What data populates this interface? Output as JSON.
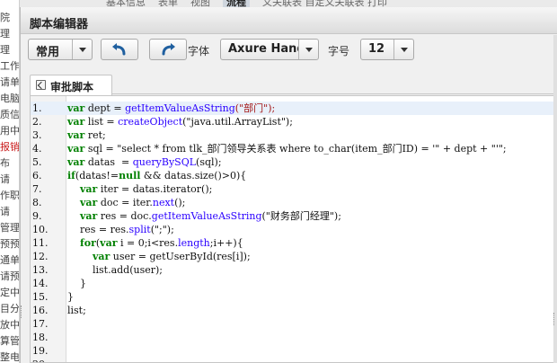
{
  "background": {
    "side_rows": [
      {
        "text": "院",
        "red": false
      },
      {
        "text": "理",
        "red": false
      },
      {
        "text": "理",
        "red": false
      },
      {
        "text": "工作",
        "red": false
      },
      {
        "text": "请单",
        "red": false
      },
      {
        "text": "电脑",
        "red": false
      },
      {
        "text": "质信",
        "red": false
      },
      {
        "text": "用中",
        "red": false
      },
      {
        "text": "报销",
        "red": true
      },
      {
        "text": "布",
        "red": false
      },
      {
        "text": "请",
        "red": false
      },
      {
        "text": "作职",
        "red": false
      },
      {
        "text": "请",
        "red": false
      },
      {
        "text": "管理",
        "red": false
      },
      {
        "text": "预预",
        "red": false
      },
      {
        "text": "通单",
        "red": false
      },
      {
        "text": "请预",
        "red": false
      },
      {
        "text": "定中",
        "red": false
      },
      {
        "text": "目分",
        "red": false
      },
      {
        "text": "放中",
        "red": false
      },
      {
        "text": "算管",
        "red": false
      },
      {
        "text": "整电",
        "red": false
      }
    ],
    "top_tabs": [
      "基本信息",
      "表单",
      "视图"
    ],
    "top_tab_active": "流程",
    "top_tabs_more": "义关联表    自定义关联表    打印"
  },
  "dialog": {
    "title": "脚本编辑器",
    "toolbar": {
      "category_value": "常用",
      "font_label": "字体",
      "font_value": "Axure Handwriting",
      "size_label": "字号",
      "size_value": "12"
    },
    "tab_label": "审批脚本"
  },
  "editor": {
    "current_line": 1,
    "lines": [
      {
        "num": "1.",
        "tokens": [
          {
            "t": "var",
            "c": "kw"
          },
          {
            "t": " dept = ",
            "c": ""
          },
          {
            "t": "getItemValueAsString",
            "c": "fn"
          },
          {
            "t": "(\"部门\");",
            "c": "str"
          }
        ]
      },
      {
        "num": "2.",
        "tokens": [
          {
            "t": "var",
            "c": "kw"
          },
          {
            "t": " list = ",
            "c": ""
          },
          {
            "t": "createObject",
            "c": "fn"
          },
          {
            "t": "(\"java.util.ArrayList\");",
            "c": ""
          }
        ]
      },
      {
        "num": "3.",
        "tokens": [
          {
            "t": "var",
            "c": "kw"
          },
          {
            "t": " ret;",
            "c": ""
          }
        ]
      },
      {
        "num": "4.",
        "tokens": [
          {
            "t": "var",
            "c": "kw"
          },
          {
            "t": " sql = \"select * from tlk_部门领导关系表 where to_char(item_部门ID) = '\" + dept + \"'\";",
            "c": ""
          }
        ]
      },
      {
        "num": "5.",
        "tokens": [
          {
            "t": "var",
            "c": "kw"
          },
          {
            "t": " datas  = ",
            "c": ""
          },
          {
            "t": "queryBySQL",
            "c": "fn"
          },
          {
            "t": "(sql);",
            "c": ""
          }
        ]
      },
      {
        "num": "6.",
        "tokens": [
          {
            "t": "if",
            "c": "kw"
          },
          {
            "t": "(datas!=",
            "c": ""
          },
          {
            "t": "null",
            "c": "kw"
          },
          {
            "t": " && datas.size()>0){",
            "c": ""
          }
        ]
      },
      {
        "num": "7.",
        "tokens": [
          {
            "t": "    ",
            "c": ""
          },
          {
            "t": "var",
            "c": "kw"
          },
          {
            "t": " iter = datas.iterator();",
            "c": ""
          }
        ]
      },
      {
        "num": "8.",
        "tokens": [
          {
            "t": "    ",
            "c": ""
          },
          {
            "t": "var",
            "c": "kw"
          },
          {
            "t": " doc = iter.",
            "c": ""
          },
          {
            "t": "next",
            "c": "fn"
          },
          {
            "t": "();",
            "c": ""
          }
        ]
      },
      {
        "num": "9.",
        "tokens": [
          {
            "t": "    ",
            "c": ""
          },
          {
            "t": "var",
            "c": "kw"
          },
          {
            "t": " res = doc.",
            "c": ""
          },
          {
            "t": "getItemValueAsString",
            "c": "fn"
          },
          {
            "t": "(\"财务部门经理\");",
            "c": ""
          }
        ]
      },
      {
        "num": "10.",
        "tokens": [
          {
            "t": "    res = res.",
            "c": ""
          },
          {
            "t": "split",
            "c": "fn"
          },
          {
            "t": "(\";\");",
            "c": ""
          }
        ]
      },
      {
        "num": "11.",
        "tokens": [
          {
            "t": "    ",
            "c": ""
          },
          {
            "t": "for",
            "c": "kw"
          },
          {
            "t": "(",
            "c": ""
          },
          {
            "t": "var",
            "c": "kw"
          },
          {
            "t": " i = 0;i<res.",
            "c": ""
          },
          {
            "t": "length",
            "c": "fn"
          },
          {
            "t": ";i++){",
            "c": ""
          }
        ]
      },
      {
        "num": "12.",
        "tokens": [
          {
            "t": "        ",
            "c": ""
          },
          {
            "t": "var",
            "c": "kw"
          },
          {
            "t": " user = getUserById(res[i]);",
            "c": ""
          }
        ]
      },
      {
        "num": "13.",
        "tokens": [
          {
            "t": "        list.add(user);",
            "c": ""
          }
        ]
      },
      {
        "num": "14.",
        "tokens": [
          {
            "t": "    }",
            "c": ""
          }
        ]
      },
      {
        "num": "15.",
        "tokens": [
          {
            "t": "}",
            "c": ""
          }
        ]
      },
      {
        "num": "16.",
        "tokens": [
          {
            "t": "list;",
            "c": ""
          }
        ]
      },
      {
        "num": "17.",
        "tokens": []
      },
      {
        "num": "18.",
        "tokens": []
      },
      {
        "num": "19.",
        "tokens": []
      },
      {
        "num": "20.",
        "tokens": []
      }
    ]
  },
  "icons": {
    "undo": "undo-arrow-icon",
    "redo": "redo-arrow-icon",
    "tab": "code-file-icon",
    "dropdown": "chevron-down-icon"
  },
  "colors": {
    "keyword": "#008000",
    "function": "#2a00ff",
    "string": "#a31515",
    "current_line": "#e8f0fa",
    "side_highlight": "#c81818"
  }
}
